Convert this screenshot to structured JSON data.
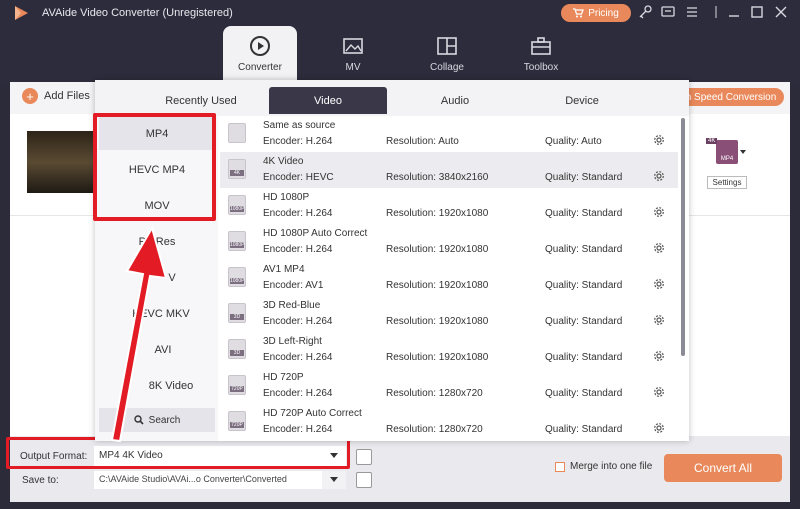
{
  "app": {
    "title": "AVAide Video Converter (Unregistered)",
    "pricing_label": "Pricing",
    "accent_color": "#e9895b"
  },
  "nav": {
    "tabs": [
      {
        "label": "Converter",
        "icon": "converter-icon"
      },
      {
        "label": "MV",
        "icon": "mv-icon"
      },
      {
        "label": "Collage",
        "icon": "collage-icon"
      },
      {
        "label": "Toolbox",
        "icon": "toolbox-icon"
      }
    ]
  },
  "toolbar": {
    "add_files_label": "Add Files",
    "speed_label": "h Speed Conversion"
  },
  "file": {
    "format_badge": "MP4",
    "format_badge_top": "4K",
    "settings_label": "Settings"
  },
  "popup": {
    "tabs": [
      "Recently Used",
      "Video",
      "Audio",
      "Device"
    ],
    "categories": [
      "MP4",
      "HEVC MP4",
      "MOV",
      "ProRes",
      "V",
      "HEVC MKV",
      "AVI",
      "8K Video"
    ],
    "search_label": "Search",
    "formats": [
      {
        "name": "Same as source",
        "encoder": "Encoder: H.264",
        "resolution": "Resolution: Auto",
        "quality": "Quality: Auto",
        "icon_label": ""
      },
      {
        "name": "4K Video",
        "encoder": "Encoder: HEVC",
        "resolution": "Resolution: 3840x2160",
        "quality": "Quality: Standard",
        "icon_label": "4K"
      },
      {
        "name": "HD 1080P",
        "encoder": "Encoder: H.264",
        "resolution": "Resolution: 1920x1080",
        "quality": "Quality: Standard",
        "icon_label": "1080P"
      },
      {
        "name": "HD 1080P Auto Correct",
        "encoder": "Encoder: H.264",
        "resolution": "Resolution: 1920x1080",
        "quality": "Quality: Standard",
        "icon_label": "1080P"
      },
      {
        "name": "AV1 MP4",
        "encoder": "Encoder: AV1",
        "resolution": "Resolution: 1920x1080",
        "quality": "Quality: Standard",
        "icon_label": "1080P"
      },
      {
        "name": "3D Red-Blue",
        "encoder": "Encoder: H.264",
        "resolution": "Resolution: 1920x1080",
        "quality": "Quality: Standard",
        "icon_label": "3D"
      },
      {
        "name": "3D Left-Right",
        "encoder": "Encoder: H.264",
        "resolution": "Resolution: 1920x1080",
        "quality": "Quality: Standard",
        "icon_label": "3D"
      },
      {
        "name": "HD 720P",
        "encoder": "Encoder: H.264",
        "resolution": "Resolution: 1280x720",
        "quality": "Quality: Standard",
        "icon_label": "720P"
      },
      {
        "name": "HD 720P Auto Correct",
        "encoder": "Encoder: H.264",
        "resolution": "Resolution: 1280x720",
        "quality": "Quality: Standard",
        "icon_label": "720P"
      }
    ]
  },
  "bottom": {
    "output_format_label": "Output Format:",
    "output_format_value": "MP4 4K Video",
    "save_to_label": "Save to:",
    "save_to_value": "C:\\AVAide Studio\\AVAi...o Converter\\Converted",
    "merge_label": "Merge into one file",
    "convert_label": "Convert All"
  }
}
